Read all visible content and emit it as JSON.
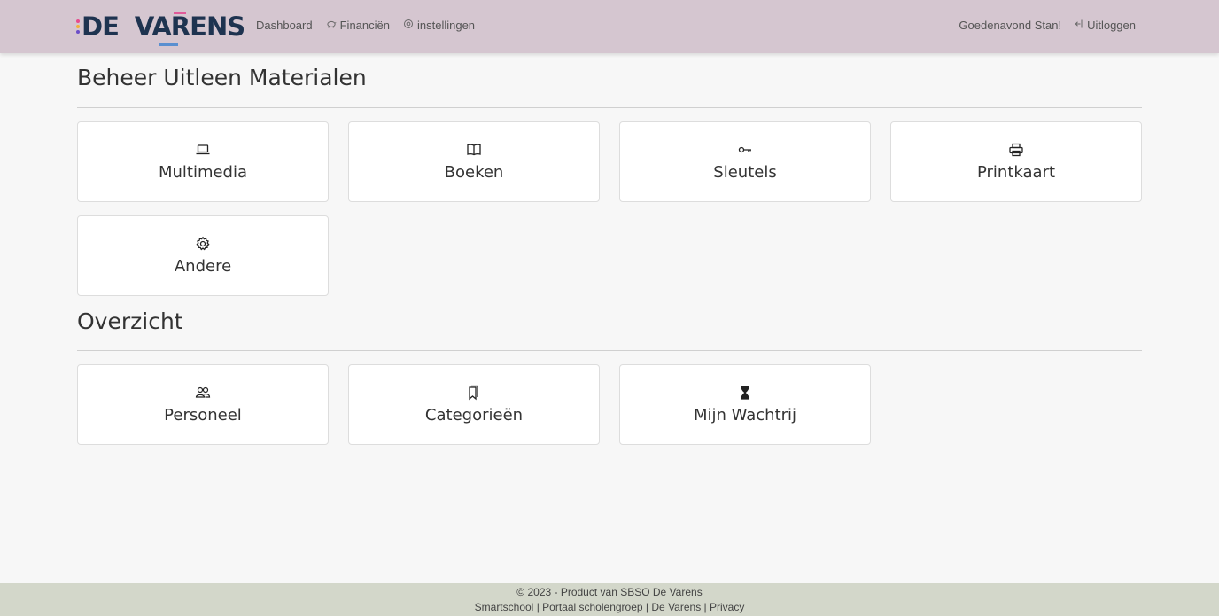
{
  "brand": {
    "logo_text_de": "DE",
    "logo_text_varens": "VARENS",
    "dot_colors": [
      "#e84a8c",
      "#f2b13a",
      "#6c4fc8"
    ]
  },
  "nav": {
    "dashboard": "Dashboard",
    "financien": "Financiën",
    "instellingen": "instellingen",
    "greeting": "Goedenavond Stan!",
    "logout": "Uitloggen"
  },
  "section1": {
    "title": "Beheer Uitleen Materialen",
    "cards": [
      {
        "label": "Multimedia",
        "icon": "laptop-icon"
      },
      {
        "label": "Boeken",
        "icon": "book-icon"
      },
      {
        "label": "Sleutels",
        "icon": "key-icon"
      },
      {
        "label": "Printkaart",
        "icon": "printer-icon"
      },
      {
        "label": "Andere",
        "icon": "gear-icon"
      }
    ]
  },
  "section2": {
    "title": "Overzicht",
    "cards": [
      {
        "label": "Personeel",
        "icon": "people-icon"
      },
      {
        "label": "Categorieën",
        "icon": "bookmarks-icon"
      },
      {
        "label": "Mijn Wachtrij",
        "icon": "hourglass-icon"
      }
    ]
  },
  "footer": {
    "copyright": "© 2023 - Product van SBSO De Varens",
    "link_smartschool": "Smartschool",
    "link_portaal": "Portaal scholengroep",
    "link_devarens": "De Varens",
    "link_privacy": "Privacy",
    "separator": "|"
  },
  "colors": {
    "navbar": "#d5c6d0",
    "footer": "#d3d7ca",
    "background": "#f7f7f7",
    "logo_navy": "#1e3350"
  }
}
